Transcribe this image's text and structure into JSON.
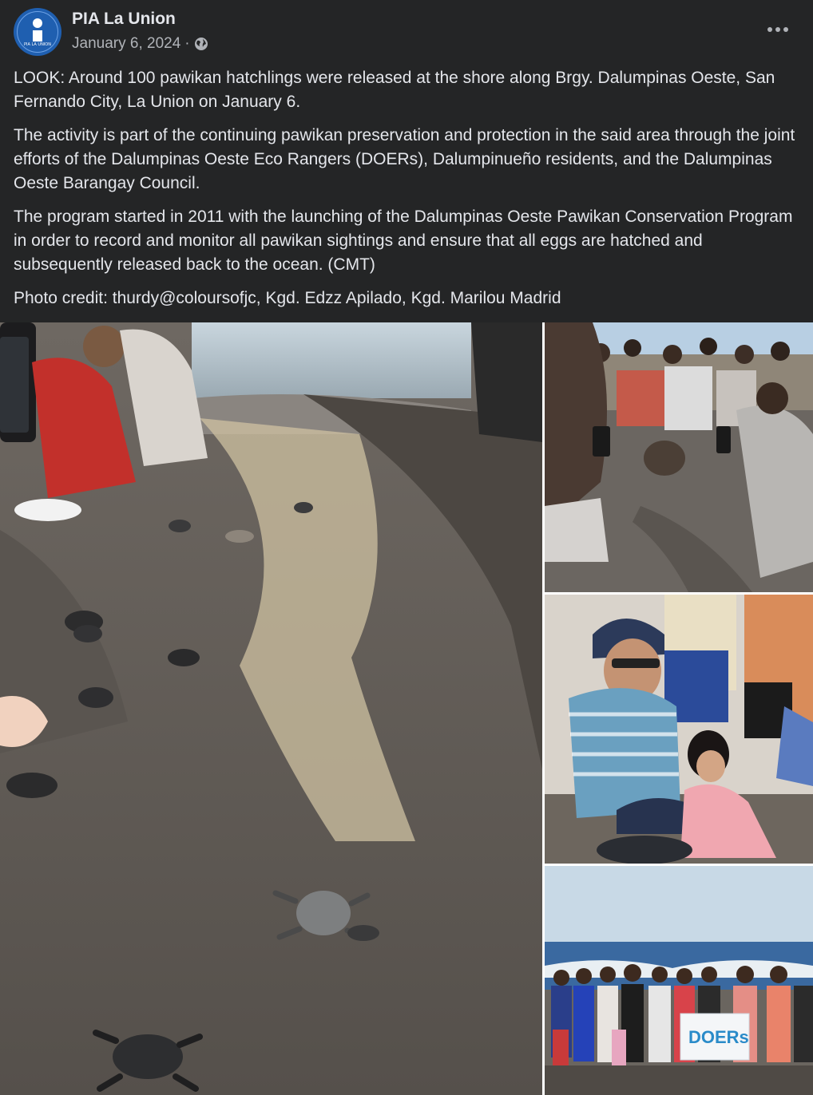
{
  "post": {
    "author": "PIA La Union",
    "avatar_text": "PIA LA UNION",
    "date": "January 6, 2024",
    "separator": "·",
    "privacy_icon": "globe-icon",
    "menu_icon": "more-horizontal-icon",
    "paragraphs": [
      "LOOK: Around 100 pawikan hatchlings were released at the shore along Brgy. Dalumpinas Oeste, San Fernando City, La Union on January 6.",
      "The activity is part of the continuing pawikan preservation and protection in the said area through the joint efforts of the Dalumpinas Oeste Eco Rangers (DOERs), Dalumpinueño residents, and the Dalumpinas Oeste Barangay Council.",
      "The program started in 2011 with the launching of the Dalumpinas Oeste Pawikan Conservation Program in order to record and monitor all pawikan sightings and ensure that all eggs are hatched and subsequently released back to the ocean. (CMT)",
      "Photo credit: thurdy@coloursofjc, Kgd. Edzz Apilado, Kgd. Marilou Madrid"
    ]
  },
  "photos": {
    "banner_text": "DOERs"
  },
  "colors": {
    "background": "#242526",
    "text_primary": "#e4e6eb",
    "text_secondary": "#b0b3b8",
    "avatar_blue": "#1f5fb0"
  }
}
